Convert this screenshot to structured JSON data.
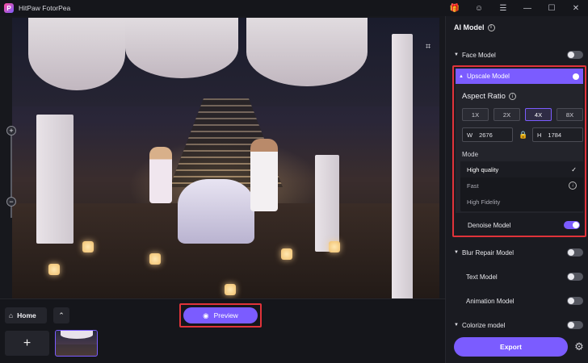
{
  "app": {
    "title": "HitPaw FotorPea",
    "logo_letter": "P"
  },
  "titlebar": {
    "gift_icon": "🎁",
    "account_icon": "☺",
    "menu_icon": "☰",
    "minimize_icon": "—",
    "maximize_icon": "☐",
    "close_icon": "✕"
  },
  "canvas": {
    "crop_icon": "⌗",
    "zoom_in": "+",
    "zoom_out": "−"
  },
  "bottom": {
    "home_label": "Home",
    "home_icon": "⌂",
    "up_icon": "⌃",
    "add_icon": "+",
    "preview_label": "Preview",
    "preview_icon": "◉"
  },
  "panel": {
    "title": "AI Model",
    "info_icon": "i",
    "face_model": {
      "label": "Face Model",
      "enabled": false
    },
    "upscale": {
      "label": "Upscale Model",
      "enabled": true,
      "aspect_ratio_title": "Aspect Ratio",
      "scales": [
        "1X",
        "2X",
        "4X",
        "8X"
      ],
      "selected_scale": "4X",
      "width_label": "W",
      "width_value": "2676",
      "height_label": "H",
      "height_value": "1784",
      "lock_icon": "🔒",
      "mode_label": "Mode",
      "modes": [
        {
          "label": "High quality",
          "selected": true,
          "mark": "✓"
        },
        {
          "label": "Fast",
          "selected": false,
          "mark": "↓"
        },
        {
          "label": "High Fidelity",
          "selected": false,
          "mark": ""
        }
      ],
      "denoise_label": "Denoise Model",
      "denoise_enabled": true
    },
    "blur_repair": {
      "label": "Blur Repair Model",
      "enabled": false
    },
    "text_model": {
      "label": "Text Model",
      "enabled": false
    },
    "animation_model": {
      "label": "Animation Model",
      "enabled": false
    },
    "colorize_model": {
      "label": "Colorize model",
      "enabled": false
    },
    "export_label": "Export",
    "settings_icon": "⚙"
  },
  "colors": {
    "accent": "#7b5cff",
    "highlight_border": "#e0333a",
    "panel_bg": "#1a1b21",
    "app_bg": "#121318"
  }
}
